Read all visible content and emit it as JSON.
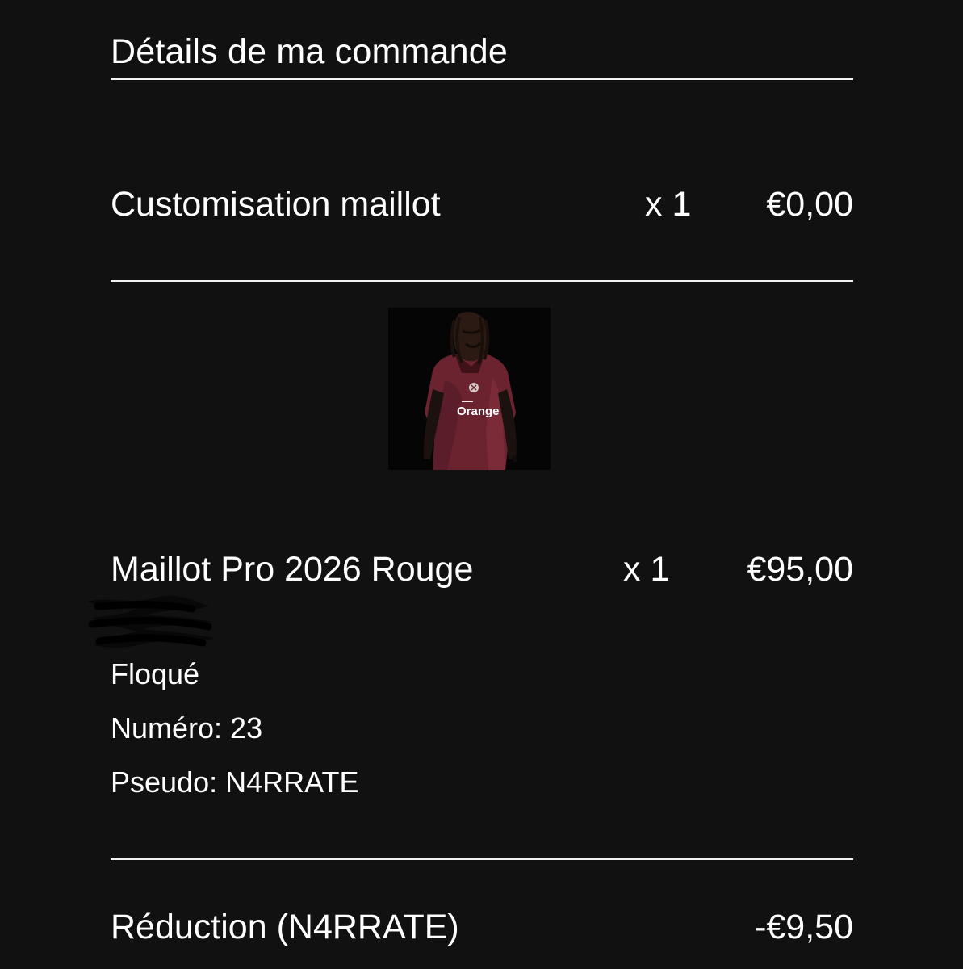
{
  "order": {
    "title": "Détails de ma commande",
    "items": [
      {
        "name": "Customisation maillot",
        "qty": "x 1",
        "price": "€0,00"
      },
      {
        "name": "Maillot Pro 2026 Rouge",
        "qty": "x 1",
        "price": "€95,00",
        "options": [
          "Floqué",
          "Numéro: 23",
          "Pseudo: N4RRATE"
        ],
        "image_text": "Orange"
      }
    ],
    "discount": {
      "label": "Réduction (N4RRATE)",
      "amount": "-€9,50"
    }
  },
  "colors": {
    "background": "#111111",
    "text": "#ffffff",
    "rule": "#f2f2f2",
    "jersey": "#6b2330"
  }
}
